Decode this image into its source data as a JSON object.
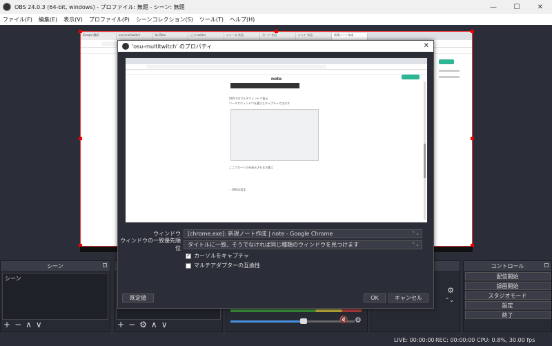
{
  "window": {
    "title": "OBS 24.0.3 (64-bit, windows) - プロファイル: 無題 - シーン: 無題",
    "min_glyph": "—",
    "max_glyph": "☐",
    "close_glyph": "✕"
  },
  "menu": [
    "ファイル(F)",
    "編集(E)",
    "表示(V)",
    "プロファイル(P)",
    "シーンコレクション(S)",
    "ツール(T)",
    "ヘルプ(H)"
  ],
  "preview": {
    "tabs": [
      "Google 翻訳",
      "osu!multitwitch",
      "YouTube",
      "ごぶ twitter",
      "シリーズ 作品",
      "カード 作品",
      "レイド 作品",
      "新規ノート作成"
    ]
  },
  "scenes_dock": {
    "title": "シーン",
    "items": [
      "シーン"
    ],
    "toolbar": [
      "+",
      "−",
      "∧",
      "∨"
    ]
  },
  "sources_dock": {
    "toolbar": [
      "+",
      "−",
      "⚙",
      "∧",
      "∨"
    ]
  },
  "controls_dock": {
    "title": "コントロール",
    "buttons": [
      "配信開始",
      "録画開始",
      "スタジオモード",
      "設定",
      "終了"
    ]
  },
  "status": {
    "live": "LIVE: 00:00:00",
    "rec": "REC: 00:00:00",
    "cpu": "CPU: 0.8%, 30.00 fps"
  },
  "dialog": {
    "title": "'osu-multitwitch' のプロパティ",
    "close_glyph": "✕",
    "preview": {
      "note_title": "note",
      "texts": [
        "OBSでのマルチウィンドウ表示",
        "ツールでウィンドウを選ぶとキャプチャできます",
        "ここでカーソルを表示させるか選ぶ",
        "・OBSの設定"
      ]
    },
    "window_label": "ウィンドウ",
    "window_value": "[chrome.exe]: 新規ノート作成 | note - Google Chrome",
    "priority_label": "ウィンドウの一致優先順位",
    "priority_value": "タイトルに一致、そうでなければ同じ種類のウィンドウを見つけます",
    "capture_cursor_label": "カーソルをキャプチャ",
    "capture_cursor_checked": true,
    "multi_adapter_label": "マルチアダプターの互換性",
    "multi_adapter_checked": false,
    "defaults_button": "既定値",
    "ok_button": "OK",
    "cancel_button": "キャンセル"
  }
}
